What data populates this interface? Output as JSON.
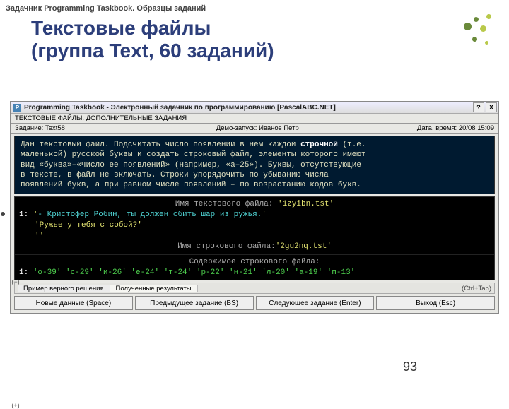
{
  "docHeader": "Задачник Programming Taskbook. Образцы заданий",
  "title": "Текстовые файлы\n(группа Text, 60 заданий)",
  "pageNumber": "93",
  "window": {
    "title": "Programming Taskbook - Электронный задачник по программированию [PascalABC.NET]",
    "help": "?",
    "close": "X",
    "info": {
      "line1a": "ТЕКСТОВЫЕ ФАЙЛЫ: ДОПОЛНИТЕЛЬНЫЕ ЗАДАНИЯ",
      "line1b": "",
      "line1c": "",
      "line2a": "Задание: Text58",
      "line2b": "Демо-запуск: Иванов Петр",
      "line2c": "Дата, время: 20/08 15:09"
    },
    "task": {
      "t1": "Дан текстовый файл. Подсчитать число появлений в нем каждой ",
      "t1b": "строчной",
      "t1c": " (т.е.",
      "t2": "маленькой) русской буквы и создать строковый файл, элементы которого имеют",
      "t3": "вид «",
      "t3b": "буква",
      "t3c": "»–«",
      "t3d": "число ее появлений",
      "t3e": "» (например, «а–25»). Буквы, отсутствующие",
      "t4": "в тексте, в файл не включать. Строки упорядочить по убыванию числа",
      "t5": "появлений букв, а при равном числе появлений – по возрастанию кодов букв."
    },
    "minus": "(−)",
    "plus": "(+)",
    "block1": {
      "head": "Имя текстового файла: ",
      "headVal": "'1zyibn.tst'",
      "lineNo": "1:",
      "q1a": "'",
      "q1b": "- Кристофер Робин, ты должен сбить шар из ружья.",
      "q1c": "'",
      "q2": "'Ружье у тебя с собой?'",
      "q3": "''",
      "foot": "Имя строкового файла:",
      "footVal": "'2gu2nq.tst'"
    },
    "block2": {
      "head": "Содержимое строкового файла:",
      "lineNo": "1:",
      "items": "'о-39' 'с-29' 'и-26' 'е-24' 'т-24' 'р-22' 'н-21' 'л-20' 'а-19' 'п-13'"
    },
    "tabs": {
      "t1": "Пример верного решения",
      "t2": "Полученные результаты",
      "hint": "(Ctrl+Tab)"
    },
    "buttons": {
      "b1": "Новые данные (Space)",
      "b2": "Предыдущее задание (BS)",
      "b3": "Следующее задание (Enter)",
      "b4": "Выход (Esc)"
    }
  }
}
